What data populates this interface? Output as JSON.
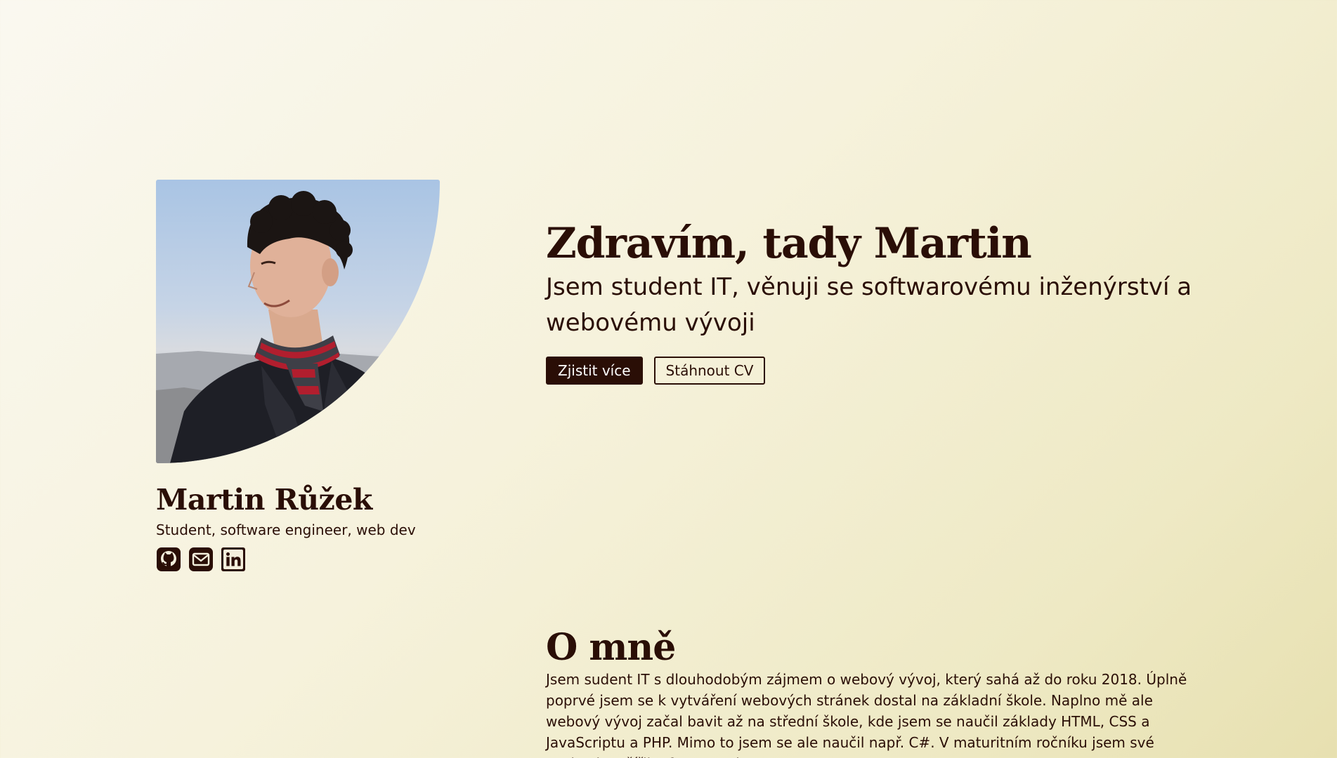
{
  "profile": {
    "name": "Martin Růžek",
    "role": "Student, software engineer, web dev",
    "photo_alt": "Portrait photo",
    "social": [
      {
        "icon": "github-icon",
        "label": "GitHub"
      },
      {
        "icon": "mail-icon",
        "label": "Email"
      },
      {
        "icon": "linkedin-icon",
        "label": "LinkedIn"
      }
    ]
  },
  "hero": {
    "title": "Zdravím, tady Martin",
    "subtitle": "Jsem student IT, věnuji se softwarovému inženýrství a webovému vývoji",
    "primary_button": "Zjistit více",
    "secondary_button": "Stáhnout CV"
  },
  "about": {
    "title": "O mně",
    "text": "Jsem sudent IT s dlouhodobým zájmem o webový vývoj, který sahá až do roku 2018. Úplně poprvé jsem se k vytváření webových stránek dostal na základní škole. Naplno mě ale webový vývoj začal bavit až na střední škole, kde jsem se naučil základy HTML, CSS a JavaScriptu a PHP. Mimo to jsem se ale naučil např. C#. V maturitním ročníku jsem své znalosti rozšířil o framework"
  },
  "colors": {
    "text": "#2a0e06",
    "primary_button_bg": "#2a0e06",
    "primary_button_text": "#ffffff",
    "background_start": "#faf8f0",
    "background_end": "#e7e0b0"
  }
}
